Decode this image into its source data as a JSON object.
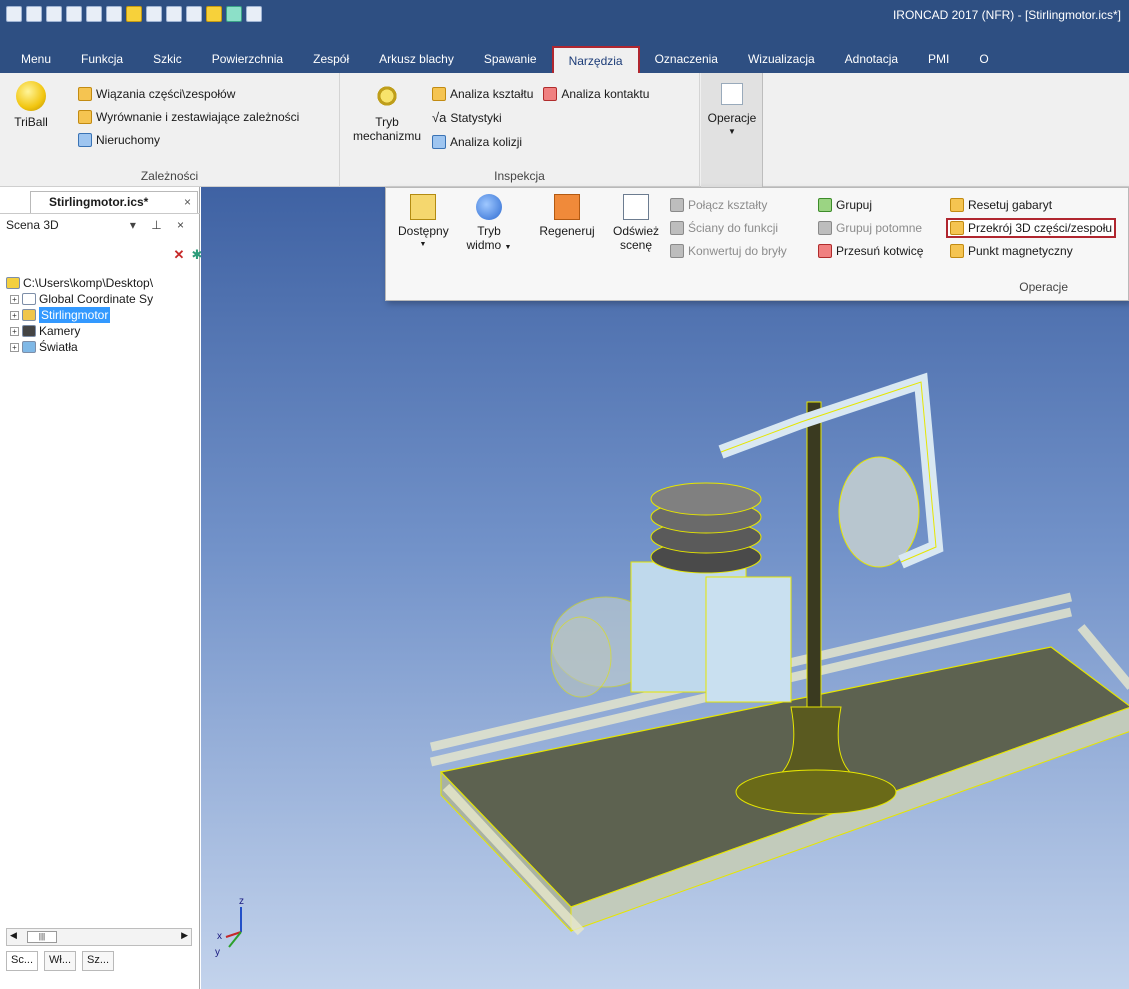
{
  "window": {
    "title": "IRONCAD 2017 (NFR) - [Stirlingmotor.ics*]",
    "qat_icons": [
      "app-icon",
      "new-icon",
      "template-icon",
      "grid-icon",
      "grid-icon",
      "grid-icon",
      "open-icon",
      "save-icon",
      "undo-icon",
      "redo-icon",
      "triball-icon",
      "sparkle-icon",
      "dropdown-icon"
    ]
  },
  "menu": {
    "tabs": [
      "Menu",
      "Funkcja",
      "Szkic",
      "Powierzchnia",
      "Zespół",
      "Arkusz blachy",
      "Spawanie",
      "Narzędzia",
      "Oznaczenia",
      "Wizualizacja",
      "Adnotacja",
      "PMI",
      "O"
    ],
    "active_index": 7
  },
  "ribbon": {
    "zaleznosci": {
      "label": "Zależności",
      "triball": "TriBall",
      "wiazania": "Wiązania części\\zespołów",
      "wyrownanie": "Wyrównanie i zestawiające zależności",
      "nieruchomy": "Nieruchomy"
    },
    "inspekcja": {
      "label": "Inspekcja",
      "tryb_line1": "Tryb",
      "tryb_line2": "mechanizmu",
      "analiza_ksztaltu": "Analiza kształtu",
      "analiza_kontaktu": "Analiza kontaktu",
      "statystyki": "Statystyki",
      "analiza_kolizji": "Analiza kolizji"
    },
    "operacje_button": "Operacje"
  },
  "operacje_popup": {
    "label": "Operacje",
    "dostepny": "Dostępny",
    "tryb_widmo_1": "Tryb",
    "tryb_widmo_2": "widmo",
    "regeneruj": "Regeneruj",
    "odswiez_1": "Odśwież",
    "odswiez_2": "scenę",
    "polacz": "Połącz kształty",
    "sciany": "Ściany do funkcji",
    "konwertuj": "Konwertuj do bryły",
    "grupuj": "Grupuj",
    "grupuj_potomne": "Grupuj potomne",
    "przesun": "Przesuń kotwicę",
    "resetuj": "Resetuj gabaryt",
    "przekroj": "Przekrój 3D części/zespołu",
    "punkt": "Punkt magnetyczny"
  },
  "left_panel": {
    "doc_tab": "Stirlingmotor.ics*",
    "pane_title": "Scena 3D",
    "tree": [
      {
        "label": "C:\\Users\\komp\\Desktop\\",
        "level": 0,
        "expander": ""
      },
      {
        "label": "Global Coordinate Sy",
        "level": 1,
        "expander": "+"
      },
      {
        "label": "Stirlingmotor",
        "level": 1,
        "expander": "+",
        "selected": true
      },
      {
        "label": "Kamery",
        "level": 1,
        "expander": "+"
      },
      {
        "label": "Światła",
        "level": 1,
        "expander": "+"
      }
    ],
    "bottom_tabs": [
      "Sc...",
      "Wł...",
      "Sz..."
    ]
  },
  "viewport": {
    "axes": [
      "z",
      "x",
      "y"
    ],
    "colors": {
      "sky_top": "#3f62a3",
      "sky_bottom": "#c3d3ec",
      "highlight": "#e6e600",
      "base": "#5d6250"
    }
  }
}
